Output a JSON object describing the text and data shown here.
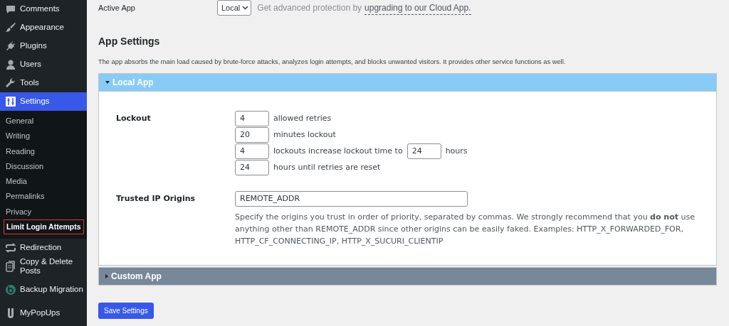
{
  "sidebar": {
    "items": [
      {
        "label": "Comments",
        "selected": false
      },
      {
        "label": "Appearance",
        "selected": false
      },
      {
        "label": "Plugins",
        "selected": false
      },
      {
        "label": "Users",
        "selected": false
      },
      {
        "label": "Tools",
        "selected": false
      },
      {
        "label": "Settings",
        "selected": true,
        "children": [
          {
            "label": "General",
            "selected": false
          },
          {
            "label": "Writing",
            "selected": false
          },
          {
            "label": "Reading",
            "selected": false
          },
          {
            "label": "Discussion",
            "selected": false
          },
          {
            "label": "Media",
            "selected": false
          },
          {
            "label": "Permalinks",
            "selected": false
          },
          {
            "label": "Privacy",
            "selected": false
          },
          {
            "label": "Limit Login Attempts",
            "selected": true
          }
        ]
      },
      {
        "label": "Redirection",
        "selected": false
      },
      {
        "label": "Copy & Delete Posts",
        "selected": false
      },
      {
        "label": "Backup Migration",
        "selected": false
      },
      {
        "label": "MyPopUps",
        "selected": false
      }
    ]
  },
  "active_app": {
    "label": "Active App",
    "value": "Local",
    "notice": "Get advanced protection by",
    "notice_link": "upgrading to our Cloud App."
  },
  "app_settings": {
    "title": "App Settings",
    "description": "The app absorbs the main load caused by brute-force attacks, analyzes login attempts, and blocks unwanted visitors. It provides other service functions as well."
  },
  "panels": [
    {
      "title": "Local App",
      "expanded": true,
      "lockout": {
        "label": "Lockout",
        "rows": [
          [
            {
              "kind": "input",
              "value": "4"
            },
            {
              "kind": "text",
              "text": "allowed retries"
            }
          ],
          [
            {
              "kind": "input",
              "value": "20"
            },
            {
              "kind": "text",
              "text": "minutes lockout"
            }
          ],
          [
            {
              "kind": "input",
              "value": "4"
            },
            {
              "kind": "text",
              "text": "lockouts increase lockout time to"
            },
            {
              "kind": "input",
              "value": "24"
            },
            {
              "kind": "text",
              "text": "hours"
            }
          ],
          [
            {
              "kind": "input",
              "value": "24"
            },
            {
              "kind": "text",
              "text": "hours until retries are reset"
            }
          ]
        ]
      },
      "trusted": {
        "label": "Trusted IP Origins",
        "value": "REMOTE_ADDR",
        "help": "Specify the origins you trust in order of priority, separated by commas. We strongly recommend that you **do not** use anything other than REMOTE_ADDR since other origins can be easily faked. Examples: HTTP_X_FORWARDED_FOR, HTTP_CF_CONNECTING_IP, HTTP_X_SUCURI_CLIENTIP"
      }
    },
    {
      "title": "Custom App",
      "expanded": false
    }
  ],
  "save_button": "Save Settings"
}
